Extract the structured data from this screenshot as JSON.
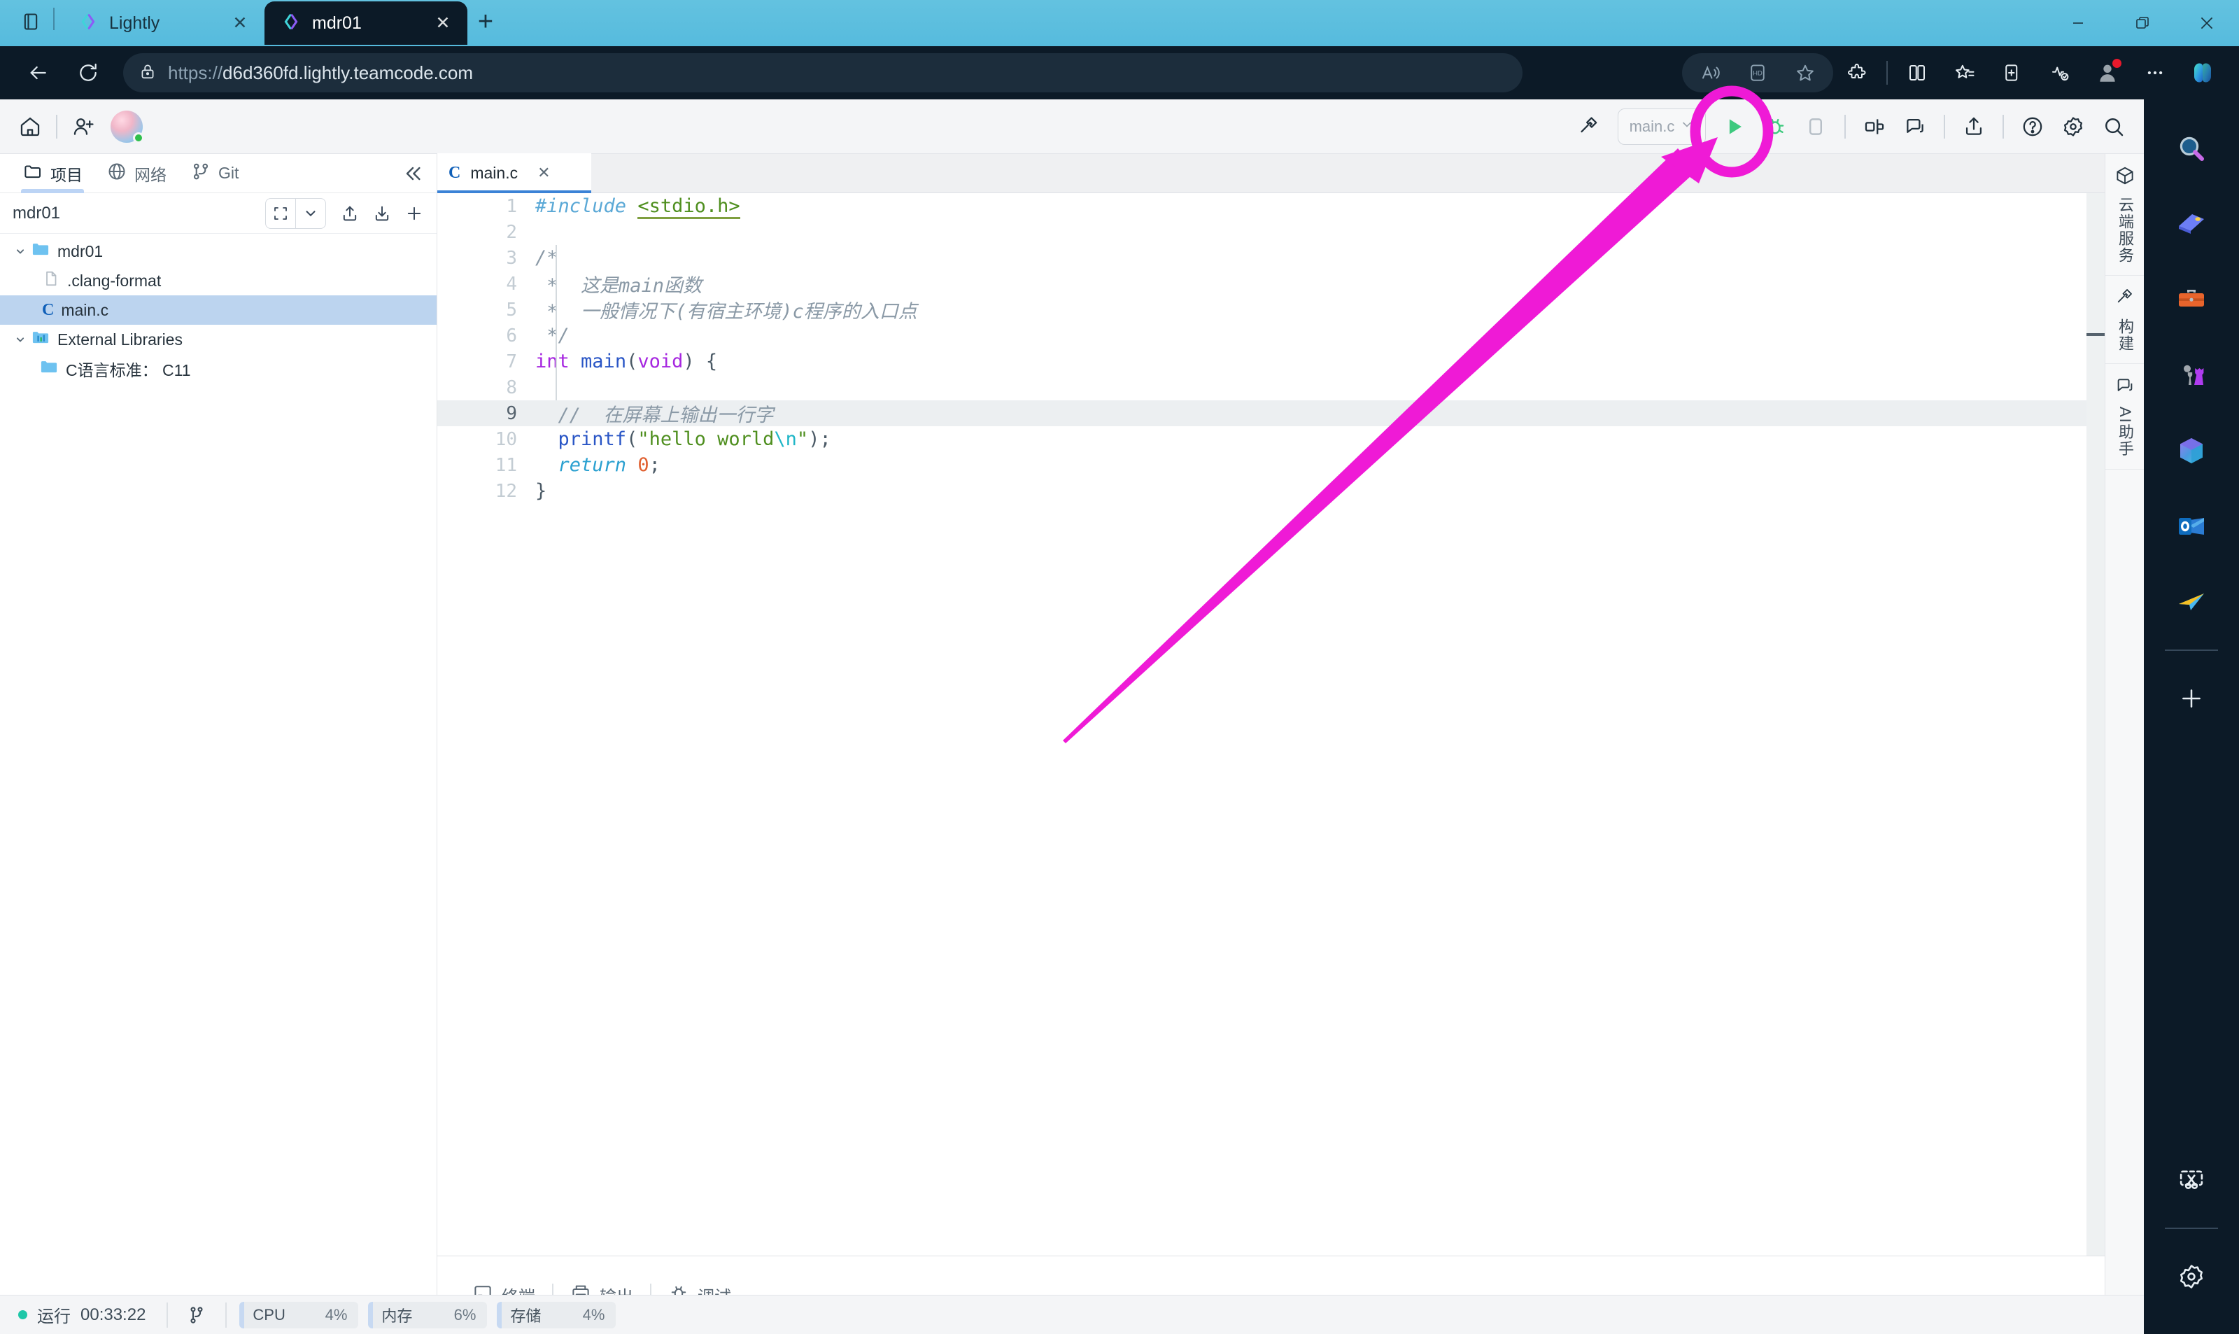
{
  "browser": {
    "tabs": [
      {
        "title": "Lightly",
        "active": false,
        "favicon": "lightly-logo-icon"
      },
      {
        "title": "mdr01",
        "active": true,
        "favicon": "lightly-logo-icon"
      }
    ],
    "new_tab_label": "+",
    "close_label": "✕",
    "address": {
      "scheme": "https://",
      "host": "d6d360fd.lightly.teamcode.com",
      "full": "https://d6d360fd.lightly.teamcode.com"
    },
    "nav_icons": [
      "back-icon",
      "reload-icon",
      "site-lock-icon"
    ],
    "toolbar_icons": [
      "read-aloud-icon",
      "hd-video-icon",
      "favorite-star-icon",
      "extensions-icon",
      "split-screen-icon",
      "favorites-list-icon",
      "collections-icon",
      "browser-essentials-icon",
      "profile-avatar-icon",
      "more-options-icon",
      "copilot-icon"
    ],
    "window_controls": [
      "minimize",
      "restore",
      "close"
    ]
  },
  "ide": {
    "topbar": {
      "icons": [
        "home-icon",
        "invite-user-icon"
      ],
      "avatar_status": "online",
      "right_icons": [
        "build-hammer-icon",
        "debug-bug-icon",
        "stop-square-icon",
        "split-editor-icon",
        "comment-icon",
        "share-upload-icon",
        "help-icon",
        "settings-gear-icon",
        "search-icon"
      ],
      "run_config": {
        "label": "main.c",
        "chevron": "⌄"
      },
      "run_button": "run-play-icon"
    },
    "left_panel": {
      "tabs": [
        {
          "label": "项目",
          "icon": "folder-icon",
          "active": true
        },
        {
          "label": "网络",
          "icon": "globe-icon",
          "active": false
        },
        {
          "label": "Git",
          "icon": "git-branch-icon",
          "active": false
        }
      ],
      "collapse_icon": "collapse-left-icon",
      "header": {
        "project_name": "mdr01",
        "tools": [
          "expand-all-icon",
          "chevron-down-icon",
          "upload-icon",
          "download-icon",
          "add-icon"
        ]
      },
      "tree": [
        {
          "label": "mdr01",
          "icon": "folder-open-icon",
          "depth": 0,
          "expanded": true,
          "selected": false
        },
        {
          "label": ".clang-format",
          "icon": "file-icon",
          "depth": 1,
          "expanded": null,
          "selected": false
        },
        {
          "label": "main.c",
          "icon": "c-file-icon",
          "depth": 1,
          "expanded": null,
          "selected": true
        },
        {
          "label": "External Libraries",
          "icon": "libraries-icon",
          "depth": 0,
          "expanded": true,
          "selected": false
        },
        {
          "label": "C语言标准： C11",
          "icon": "folder-icon",
          "depth": 1,
          "expanded": null,
          "selected": false
        }
      ]
    },
    "editor": {
      "tabs": [
        {
          "label": "main.c",
          "icon": "c-file-icon",
          "active": true,
          "close": "✕"
        }
      ],
      "current_line": 9,
      "lines": [
        {
          "n": 1,
          "tokens": [
            {
              "t": "#include",
              "c": "k-pre"
            },
            {
              "t": " ",
              "c": "k-plain"
            },
            {
              "t": "<stdio.h>",
              "c": "k-hdr"
            }
          ]
        },
        {
          "n": 2,
          "tokens": []
        },
        {
          "n": 3,
          "tokens": [
            {
              "t": "/*",
              "c": "k-cmt"
            }
          ]
        },
        {
          "n": 4,
          "tokens": [
            {
              "t": " *  这是main函数",
              "c": "k-cmt"
            }
          ]
        },
        {
          "n": 5,
          "tokens": [
            {
              "t": " *  一般情况下(有宿主环境)c程序的入口点",
              "c": "k-cmt"
            }
          ]
        },
        {
          "n": 6,
          "tokens": [
            {
              "t": " */",
              "c": "k-cmt"
            }
          ]
        },
        {
          "n": 7,
          "tokens": [
            {
              "t": "int",
              "c": "k-type"
            },
            {
              "t": " ",
              "c": "k-plain"
            },
            {
              "t": "main",
              "c": "k-fn"
            },
            {
              "t": "(",
              "c": "k-punc"
            },
            {
              "t": "void",
              "c": "k-type"
            },
            {
              "t": ") {",
              "c": "k-punc"
            }
          ]
        },
        {
          "n": 8,
          "tokens": []
        },
        {
          "n": 9,
          "tokens": [
            {
              "t": "  //  在屏幕上输出一行字",
              "c": "k-cmt"
            }
          ]
        },
        {
          "n": 10,
          "tokens": [
            {
              "t": "  ",
              "c": "k-plain"
            },
            {
              "t": "printf",
              "c": "k-fn"
            },
            {
              "t": "(",
              "c": "k-punc"
            },
            {
              "t": "\"hello world",
              "c": "k-str"
            },
            {
              "t": "\\n",
              "c": "k-esc"
            },
            {
              "t": "\"",
              "c": "k-str"
            },
            {
              "t": ");",
              "c": "k-punc"
            }
          ]
        },
        {
          "n": 11,
          "tokens": [
            {
              "t": "  ",
              "c": "k-plain"
            },
            {
              "t": "return",
              "c": "k-kw"
            },
            {
              "t": " ",
              "c": "k-plain"
            },
            {
              "t": "0",
              "c": "k-num"
            },
            {
              "t": ";",
              "c": "k-punc"
            }
          ]
        },
        {
          "n": 12,
          "tokens": [
            {
              "t": "}",
              "c": "k-punc"
            }
          ]
        }
      ]
    },
    "bottom_tabs": [
      {
        "label": "终端",
        "icon": "terminal-icon"
      },
      {
        "label": "输出",
        "icon": "output-icon"
      },
      {
        "label": "调试",
        "icon": "debug-icon"
      }
    ],
    "right_tabs": [
      {
        "label": "云端服务",
        "icon": "cloud-service-cube-icon"
      },
      {
        "label": "构建",
        "icon": "build-hammer-icon"
      },
      {
        "label": "AI助手",
        "icon": "ai-assistant-icon"
      }
    ],
    "statusbar": {
      "run_state": "运行",
      "uptime": "00:33:22",
      "git_icon": "git-branch-icon",
      "meters": [
        {
          "label": "CPU",
          "value": "4%"
        },
        {
          "label": "内存",
          "value": "6%"
        },
        {
          "label": "存储",
          "value": "4%"
        }
      ]
    }
  },
  "edge_sidebar": {
    "icons": [
      "search-icon",
      "shopping-tag-icon",
      "tools-briefcase-icon",
      "games-icon",
      "microsoft365-icon",
      "outlook-icon",
      "send-plane-icon",
      "add-icon",
      "screenshot-scissors-icon",
      "settings-gear-icon"
    ]
  },
  "annotation": {
    "color": "#ef1ad6",
    "circle_target": "run-play-icon",
    "shape": "arrow-pointing-to-run-button"
  }
}
